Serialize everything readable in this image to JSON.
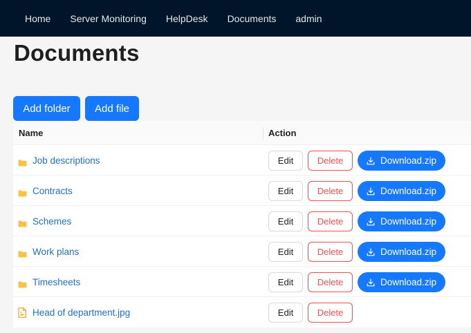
{
  "nav": {
    "items": [
      "Home",
      "Server Monitoring",
      "HelpDesk",
      "Documents",
      "admin"
    ]
  },
  "page": {
    "title": "Documents",
    "add_folder_label": "Add folder",
    "add_file_label": "Add file"
  },
  "table": {
    "headers": {
      "name": "Name",
      "action": "Action"
    },
    "rows": [
      {
        "name": "Job descriptions",
        "type": "folder",
        "icon": "folder-icon"
      },
      {
        "name": "Contracts",
        "type": "folder",
        "icon": "folder-icon"
      },
      {
        "name": "Schemes",
        "type": "folder",
        "icon": "folder-icon"
      },
      {
        "name": "Work plans",
        "type": "folder",
        "icon": "folder-icon"
      },
      {
        "name": "Timesheets",
        "type": "folder",
        "icon": "folder-icon"
      },
      {
        "name": "Head of department.jpg",
        "type": "file",
        "icon": "image-file-icon"
      }
    ],
    "actions": {
      "edit_label": "Edit",
      "delete_label": "Delete",
      "download_label": "Download.zip"
    }
  },
  "colors": {
    "navbar_bg": "#001529",
    "primary": "#1677ff",
    "danger": "#ff4d4f",
    "link": "#1f6fd0",
    "folder": "#f7c245",
    "file_icon": "#f0a020"
  }
}
